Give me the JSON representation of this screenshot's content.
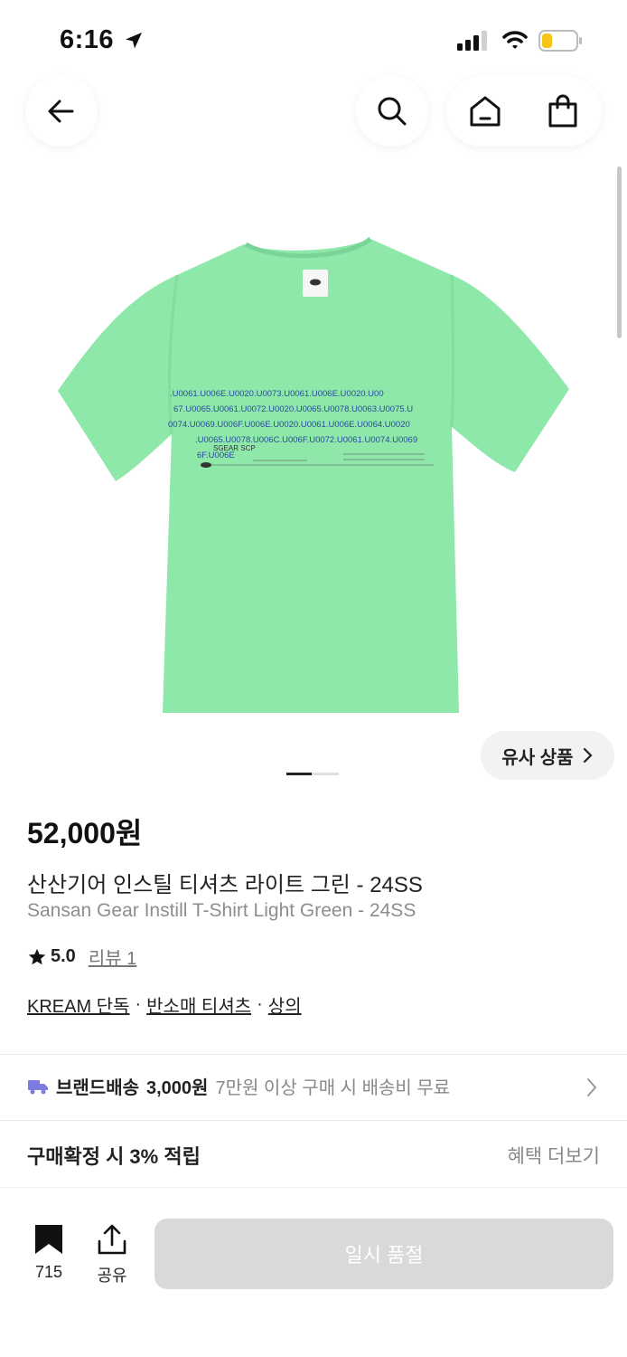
{
  "status_bar": {
    "time": "6:16",
    "battery_level": 0.3,
    "battery_color": "#f5c518"
  },
  "nav": {
    "back_icon": "arrow-left-icon",
    "search_icon": "search-icon",
    "home_icon": "home-icon",
    "bag_icon": "shopping-bag-icon"
  },
  "product": {
    "image_color": "#8de8a9",
    "image_print_lines": [
      ".U0061.U006E.U0020.U0073.U0061.U006E.U0020.U00",
      "67.U0065.U0061.U0072.U0020.U0065.U0078.U0063.U0075.U",
      "0074.U0069.U006F.U006E.U0020.U0061.U006E.U0064.U0020",
      ".U0065.U0078.U006C.U006F.U0072.U0061.U0074.U0069",
      "6F.U006E"
    ],
    "image_print_brand": "SGEAR SCP",
    "similar_label": "유사 상품",
    "carousel_total": 2,
    "carousel_index": 1,
    "price": "52,000원",
    "title_ko": "산산기어 인스틸 티셔츠 라이트 그린 - 24SS",
    "title_en": "Sansan Gear Instill T-Shirt Light Green - 24SS",
    "rating": "5.0",
    "review_label": "리뷰 1",
    "tags": [
      "KREAM 단독",
      "반소매 티셔츠",
      "상의"
    ],
    "tag_separator": "·"
  },
  "shipping": {
    "icon": "truck-icon",
    "icon_color": "#7b7be0",
    "label": "브랜드배송",
    "fee": "3,000원",
    "note": "7만원 이상 구매 시 배송비 무료"
  },
  "benefit": {
    "label": "구매확정 시 3% 적립",
    "more": "혜택 더보기"
  },
  "bottom_bar": {
    "save_count": "715",
    "share_label": "공유",
    "action_label": "일시 품절"
  }
}
